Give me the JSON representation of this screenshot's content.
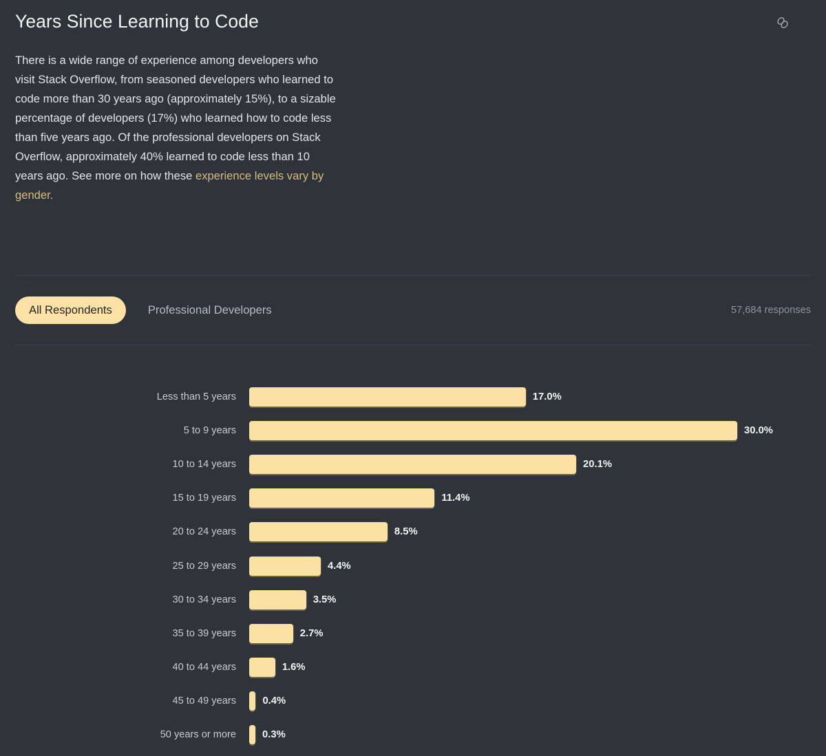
{
  "header": {
    "title": "Years Since Learning to Code",
    "link_icon": "link-icon"
  },
  "description": {
    "part1": "There is a wide range of experience among developers who visit Stack Overflow, from seasoned developers who learned to code more than 30 years ago (approximately 15%), to a sizable percentage of developers (17%) who learned how to code less than five years ago. Of the professional developers on Stack Overflow, approximately 40% learned to code less than 10 years ago. See more on how these ",
    "link_text": "experience levels vary by gender.",
    "link_color": "#d6bc80"
  },
  "tabs": [
    {
      "label": "All Respondents",
      "active": true
    },
    {
      "label": "Professional Developers",
      "active": false
    }
  ],
  "responses_text": "57,684 responses",
  "colors": {
    "background": "#2f333a",
    "bar": "#fbe1a4",
    "accent": "#fde2a6",
    "divider": "#3c4048",
    "label_text": "#c7ccd2",
    "value_text": "#f3f4f6"
  },
  "chart_data": {
    "type": "bar",
    "orientation": "horizontal",
    "title": "Years Since Learning to Code",
    "xlabel": "",
    "ylabel": "",
    "grid": false,
    "legend": "none",
    "xlim": [
      0,
      30
    ],
    "value_suffix": "%",
    "categories": [
      "Less than 5 years",
      "5 to 9 years",
      "10 to 14 years",
      "15 to 19 years",
      "20 to 24 years",
      "25 to 29 years",
      "30 to 34 years",
      "35 to 39 years",
      "40 to 44 years",
      "45 to 49 years",
      "50 years or more"
    ],
    "values": [
      17.0,
      30.0,
      20.1,
      11.4,
      8.5,
      4.4,
      3.5,
      2.7,
      1.6,
      0.4,
      0.3
    ],
    "labels": [
      "17.0%",
      "30.0%",
      "20.1%",
      "11.4%",
      "8.5%",
      "4.4%",
      "3.5%",
      "2.7%",
      "1.6%",
      "0.4%",
      "0.3%"
    ]
  }
}
